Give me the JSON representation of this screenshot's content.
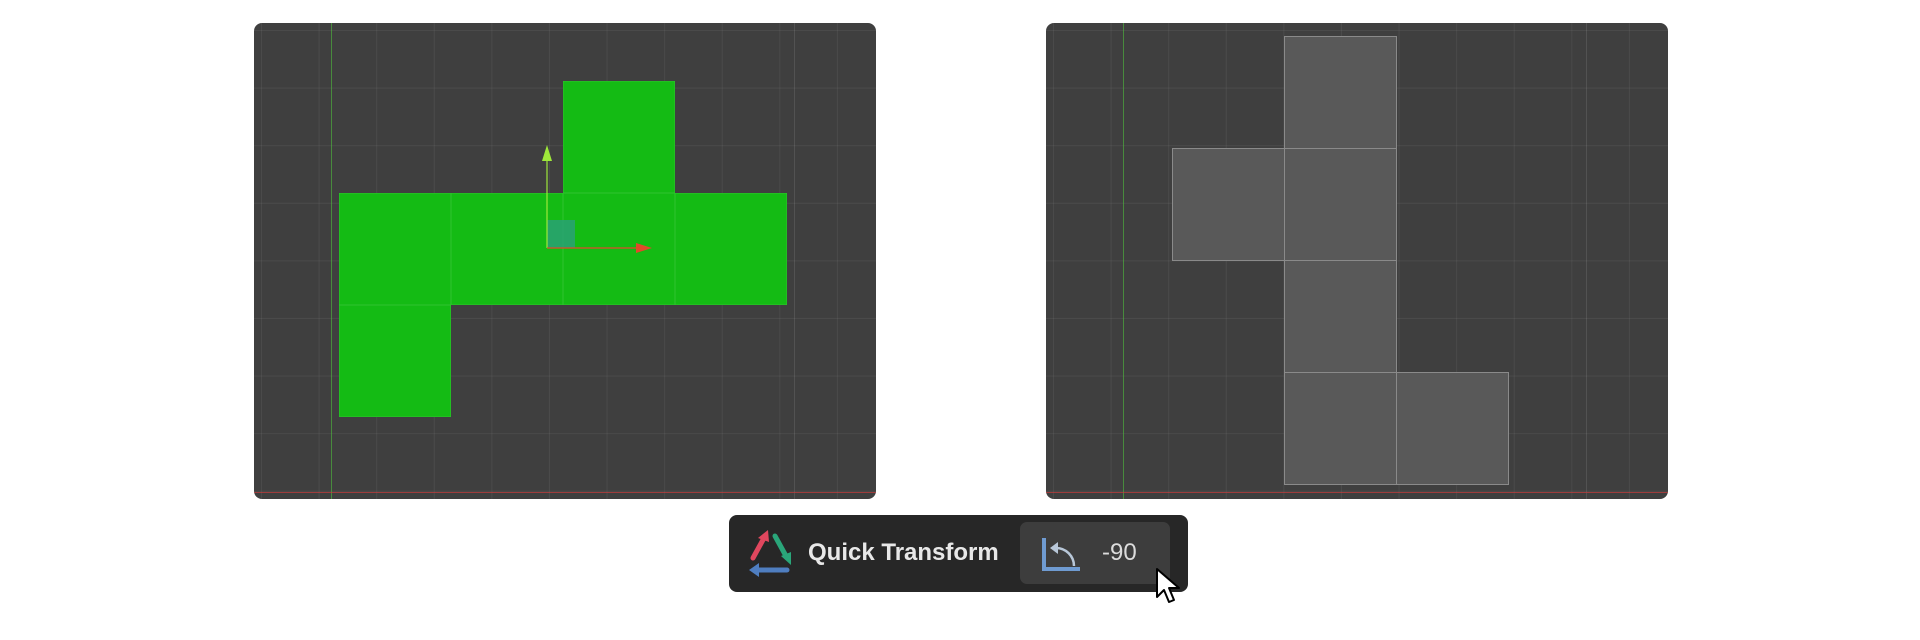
{
  "colors": {
    "viewport_bg": "#3f3f3f",
    "selected_fill": "#14bb14",
    "ghost_fill": "#595959",
    "ghost_outline": "#8a8a8a",
    "axis_x": "#e04a2a",
    "axis_y": "#9ee83a",
    "toolbar_bg": "#272727",
    "rotate_icon": "#6f9bd1"
  },
  "left_viewport": {
    "state": "selected shape with transform gizmo"
  },
  "right_viewport": {
    "state": "ghost preview of rotated shape"
  },
  "toolbar": {
    "title": "Quick Transform",
    "rotate_value": "-90",
    "logo_icon": "quick-transform-triangle-arrows",
    "rotate_icon": "rotate-angle-icon"
  }
}
